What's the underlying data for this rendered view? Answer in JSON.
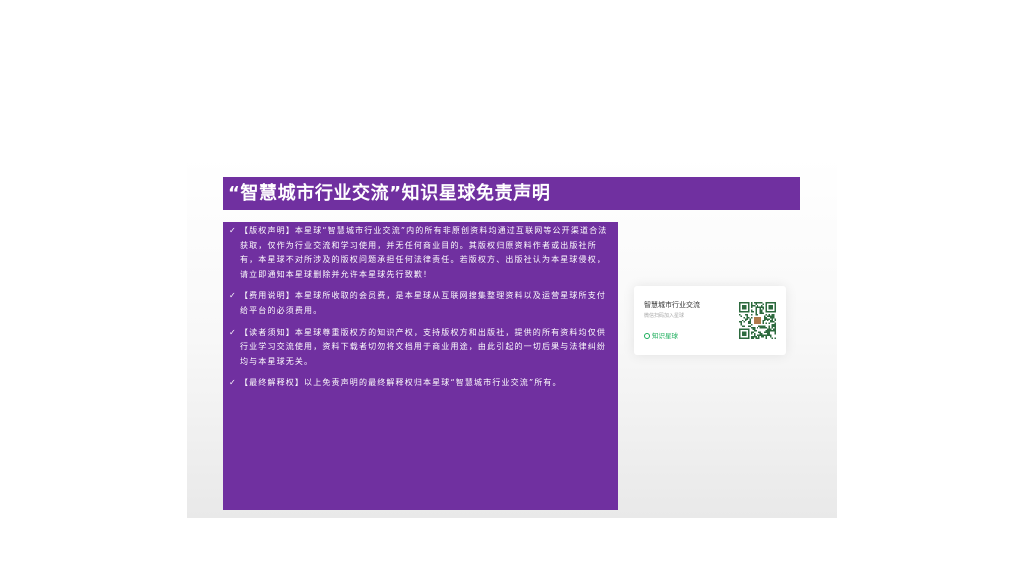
{
  "slide": {
    "title": "“智慧城市行业交流”知识星球免责声明"
  },
  "icons": {
    "check": "✓",
    "brand": "zsxq-logo-icon",
    "qr": "qr-code"
  },
  "content": {
    "items": [
      {
        "text": "【版权声明】本星球“智慧城市行业交流”内的所有非原创资料均通过互联网等公开渠道合法获取，仅作为行业交流和学习使用，并无任何商业目的。其版权归原资料作者或出版社所有，本星球不对所涉及的版权问题承担任何法律责任。若版权方、出版社认为本星球侵权，请立即通知本星球删除并允许本星球先行致歉！"
      },
      {
        "text": "【费用说明】本星球所收取的会员费，是本星球从互联网搜集整理资料以及运营星球所支付给平台的必须费用。"
      },
      {
        "text": "【读者须知】本星球尊重版权方的知识产权，支持版权方和出版社，提供的所有资料均仅供行业学习交流使用，资料下载者切勿将文档用于商业用途，由此引起的一切后果与法律纠纷均与本星球无关。"
      },
      {
        "text": "【最终解释权】以上免责声明的最终解释权归本星球“智慧城市行业交流”所有。"
      }
    ]
  },
  "card": {
    "name": "智慧城市行业交流",
    "subtitle": "微信扫码加入星球",
    "brand": "知识星球"
  },
  "colors": {
    "purple": "#7030a0",
    "green": "#1aad5a",
    "qr": "#2d6a3e"
  }
}
